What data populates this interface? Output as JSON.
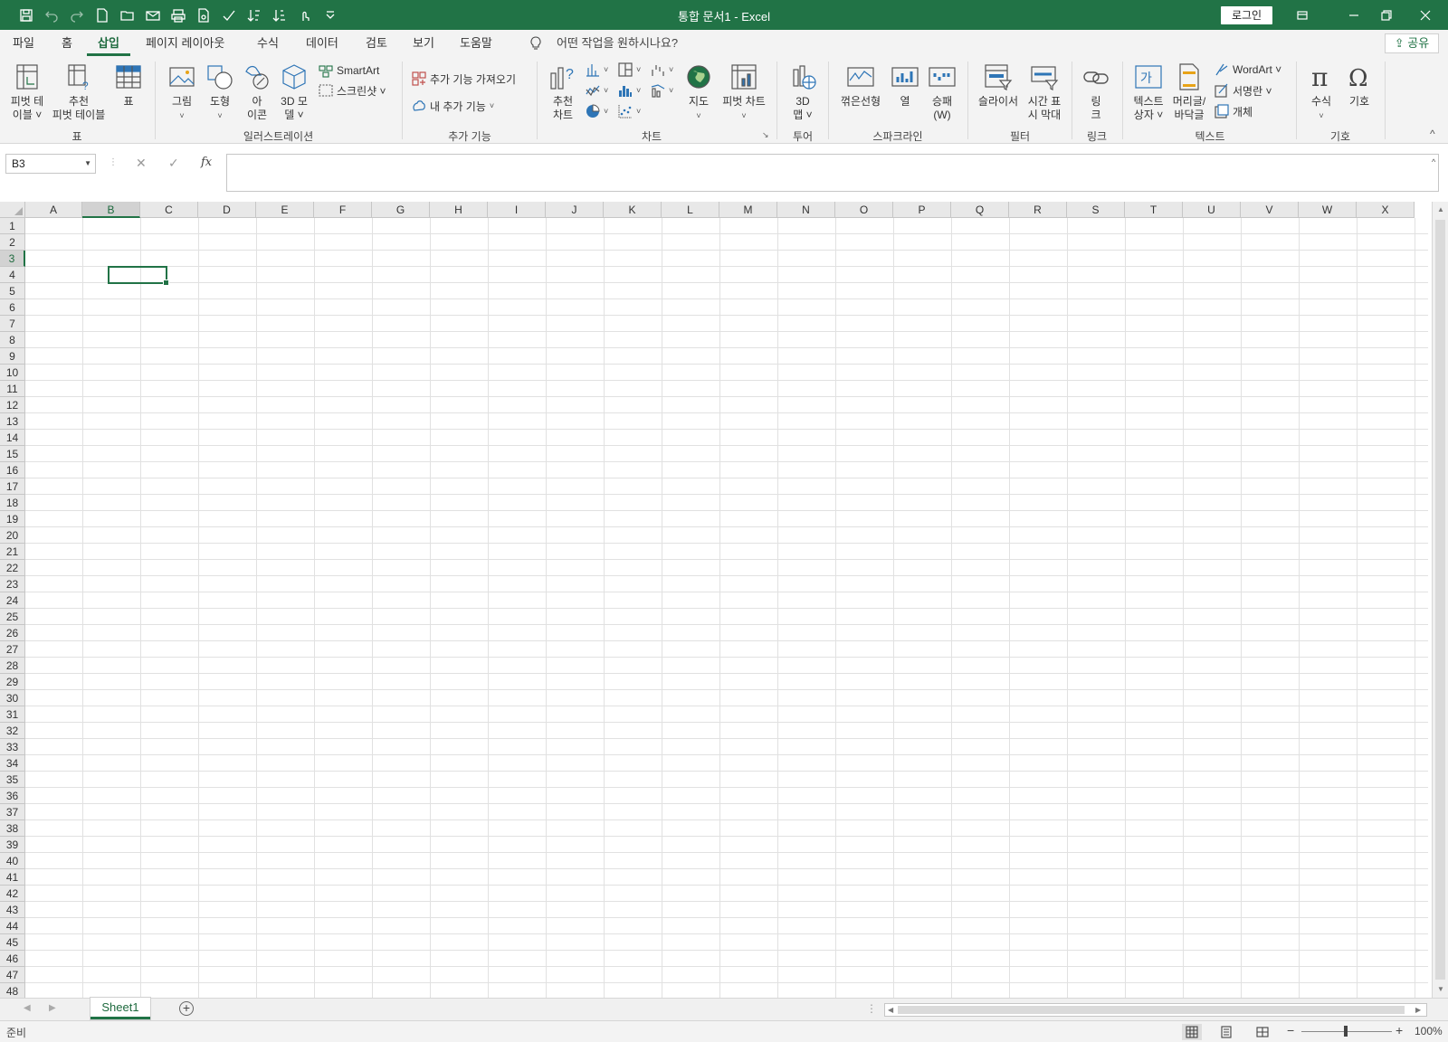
{
  "window": {
    "title": "통합 문서1  -  Excel",
    "login_label": "로그인",
    "share_label": "공유"
  },
  "tabs": [
    {
      "label": "파일"
    },
    {
      "label": "홈"
    },
    {
      "label": "삽입",
      "active": true
    },
    {
      "label": "페이지 레이아웃"
    },
    {
      "label": "수식"
    },
    {
      "label": "데이터"
    },
    {
      "label": "검토"
    },
    {
      "label": "보기"
    },
    {
      "label": "도움말"
    }
  ],
  "tellme": "어떤 작업을 원하시나요?",
  "ribbon": {
    "groups": {
      "table": "표",
      "illustrations": "일러스트레이션",
      "addins": "추가 기능",
      "charts": "차트",
      "tours": "투어",
      "sparklines": "스파크라인",
      "filters": "필터",
      "links": "링크",
      "text": "텍스트",
      "symbols": "기호"
    },
    "buttons": {
      "pivot_table": [
        "피벗 테",
        "이블 ˅"
      ],
      "recommended_pivot": [
        "추천",
        "피벗 테이블"
      ],
      "table": [
        "표"
      ],
      "pictures": [
        "그림",
        "˅"
      ],
      "shapes": [
        "도형",
        "˅"
      ],
      "icons": [
        "아",
        "이콘"
      ],
      "model3d": [
        "3D 모",
        "델 ˅"
      ],
      "smartart": "SmartArt",
      "screenshot": "스크린샷 ˅",
      "get_addins": "추가 기능 가져오기",
      "my_addins": "내 추가 기능",
      "recommended_charts": [
        "추천",
        "차트"
      ],
      "maps": [
        "지도",
        "˅"
      ],
      "pivot_chart": [
        "피벗 차트",
        "˅"
      ],
      "map3d": [
        "3D",
        "맵 ˅"
      ],
      "sparkline_line": [
        "꺾은선형"
      ],
      "sparkline_column": [
        "열"
      ],
      "sparkline_winloss": [
        "승패",
        "(W)"
      ],
      "slicer": [
        "슬라이서"
      ],
      "timeline": [
        "시간 표",
        "시 막대"
      ],
      "link": [
        "링",
        "크"
      ],
      "textbox": [
        "텍스트",
        "상자 ˅"
      ],
      "header_footer": [
        "머리글/",
        "바닥글"
      ],
      "wordart": "WordArt ˅",
      "signature": "서명란  ˅",
      "object": "개체",
      "equation": [
        "수식",
        "˅"
      ],
      "symbol": [
        "기호"
      ]
    }
  },
  "formula_bar": {
    "name_box": "B3",
    "fx": "fx",
    "value": ""
  },
  "grid": {
    "columns": [
      "A",
      "B",
      "C",
      "D",
      "E",
      "F",
      "G",
      "H",
      "I",
      "J",
      "K",
      "L",
      "M",
      "N",
      "O",
      "P",
      "Q",
      "R",
      "S",
      "T",
      "U",
      "V",
      "W",
      "X"
    ],
    "rows": [
      "1",
      "2",
      "3",
      "4",
      "5",
      "6",
      "7",
      "8",
      "9",
      "10",
      "11",
      "12",
      "13",
      "14",
      "15",
      "16",
      "17",
      "18",
      "19",
      "20",
      "21",
      "22",
      "23",
      "24",
      "25",
      "26",
      "27",
      "28",
      "29",
      "30",
      "31",
      "32",
      "33",
      "34",
      "35",
      "36",
      "37",
      "38",
      "39",
      "40",
      "41",
      "42",
      "43",
      "44",
      "45",
      "46",
      "47",
      "48"
    ],
    "active_cell": "B3"
  },
  "sheets": [
    {
      "label": "Sheet1",
      "active": true
    }
  ],
  "status": {
    "text": "준비",
    "zoom": "100%"
  },
  "colors": {
    "accent": "#217346",
    "ribbon_bg": "#f3f3f3"
  }
}
